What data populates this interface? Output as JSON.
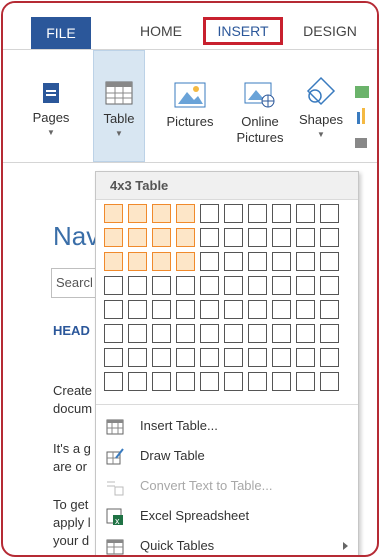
{
  "tabs": [
    {
      "label": "FILE"
    },
    {
      "label": "HOME"
    },
    {
      "label": "INSERT"
    },
    {
      "label": "DESIGN"
    }
  ],
  "ribbon": {
    "pages": {
      "label": "Pages"
    },
    "table": {
      "label": "Table"
    },
    "pictures": {
      "label": "Pictures"
    },
    "online_pictures": {
      "label": "Online Pictures"
    },
    "shapes": {
      "label": "Shapes"
    }
  },
  "nav_pane": {
    "title": "Nav",
    "search_placeholder": "Searcl",
    "headings_tab": "HEAD",
    "body_lines": [
      "Create",
      "docum",
      "It's a g",
      "are or",
      "To get",
      "apply l",
      "your d"
    ]
  },
  "table_menu": {
    "grid_label": "4x3 Table",
    "grid_cols": 10,
    "grid_rows": 8,
    "selected_cols": 4,
    "selected_rows": 3,
    "items": [
      {
        "label": "Insert Table...",
        "icon": "insert-table-icon",
        "enabled": true
      },
      {
        "label": "Draw Table",
        "icon": "draw-table-icon",
        "enabled": true
      },
      {
        "label": "Convert Text to Table...",
        "icon": "convert-text-icon",
        "enabled": false
      },
      {
        "label": "Excel Spreadsheet",
        "icon": "excel-icon",
        "enabled": true
      },
      {
        "label": "Quick Tables",
        "icon": "quick-tables-icon",
        "enabled": true,
        "submenu": true
      }
    ]
  },
  "colors": {
    "file_tab": "#2b579a",
    "highlight_border": "#c8202e",
    "grid_selected_border": "#f08a2c",
    "grid_selected_fill": "#fde6c8"
  }
}
